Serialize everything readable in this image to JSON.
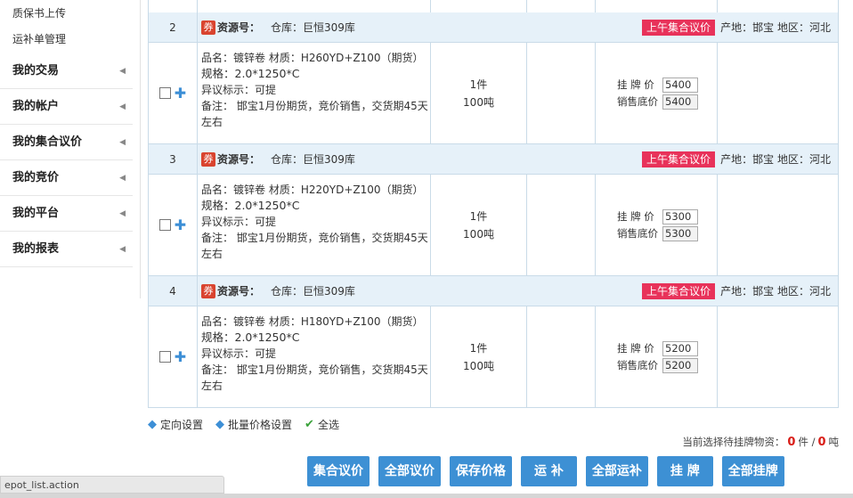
{
  "sidebar": {
    "sub_items": [
      "质保书上传",
      "运补单管理"
    ],
    "menu_items": [
      "我的交易",
      "我的帐户",
      "我的集合议价",
      "我的竞价",
      "我的平台",
      "我的报表"
    ]
  },
  "listings": [
    {
      "seq": "2",
      "res_label": "资源号：",
      "warehouse": "仓库：巨恒309库",
      "badge": "上午集合议价",
      "origin": "产地：邯宝 地区：河北",
      "name": "品名：镀锌卷  材质：H260YD+Z100（期货）",
      "spec": "规格：2.0*1250*C",
      "tag": "异议标示：可提",
      "note": "备注： 邯宝1月份期货，竞价销售，交货期45天左右",
      "qty_pieces": "1件",
      "qty_weight": "100吨",
      "list_price_label": "挂 牌 价",
      "list_price": "5400",
      "floor_price_label": "销售底价",
      "floor_price": "5400"
    },
    {
      "seq": "3",
      "res_label": "资源号：",
      "warehouse": "仓库：巨恒309库",
      "badge": "上午集合议价",
      "origin": "产地：邯宝 地区：河北",
      "name": "品名：镀锌卷  材质：H220YD+Z100（期货）",
      "spec": "规格：2.0*1250*C",
      "tag": "异议标示：可提",
      "note": "备注： 邯宝1月份期货，竞价销售，交货期45天左右",
      "qty_pieces": "1件",
      "qty_weight": "100吨",
      "list_price_label": "挂 牌 价",
      "list_price": "5300",
      "floor_price_label": "销售底价",
      "floor_price": "5300"
    },
    {
      "seq": "4",
      "res_label": "资源号：",
      "warehouse": "仓库：巨恒309库",
      "badge": "上午集合议价",
      "origin": "产地：邯宝 地区：河北",
      "name": "品名：镀锌卷  材质：H180YD+Z100（期货）",
      "spec": "规格：2.0*1250*C",
      "tag": "异议标示：可提",
      "note": "备注： 邯宝1月份期货，竞价销售，交货期45天左右",
      "qty_pieces": "1件",
      "qty_weight": "100吨",
      "list_price_label": "挂 牌 价",
      "list_price": "5200",
      "floor_price_label": "销售底价",
      "floor_price": "5200"
    }
  ],
  "tools": {
    "directed": "定向设置",
    "batch_price": "批量价格设置",
    "select_all": "全选"
  },
  "summary": {
    "prefix": "当前选择待挂牌物资：",
    "pieces": "0",
    "pieces_unit": "件 /",
    "tons": "0",
    "tons_unit": "吨"
  },
  "buttons": [
    "集合议价",
    "全部议价",
    "保存价格",
    "运 补",
    "全部运补",
    "挂 牌",
    "全部挂牌"
  ],
  "status_bar": "epot_list.action",
  "colors": {
    "badge": "#e8325a",
    "button": "#3d90d4",
    "header_bg": "#e6f1f9",
    "resource_icon": "#d9442f"
  },
  "icons": {
    "resource": "ticket-icon",
    "row_action": "plus-icon",
    "tool": "tag-icon",
    "select_all": "checkmark-icon"
  }
}
